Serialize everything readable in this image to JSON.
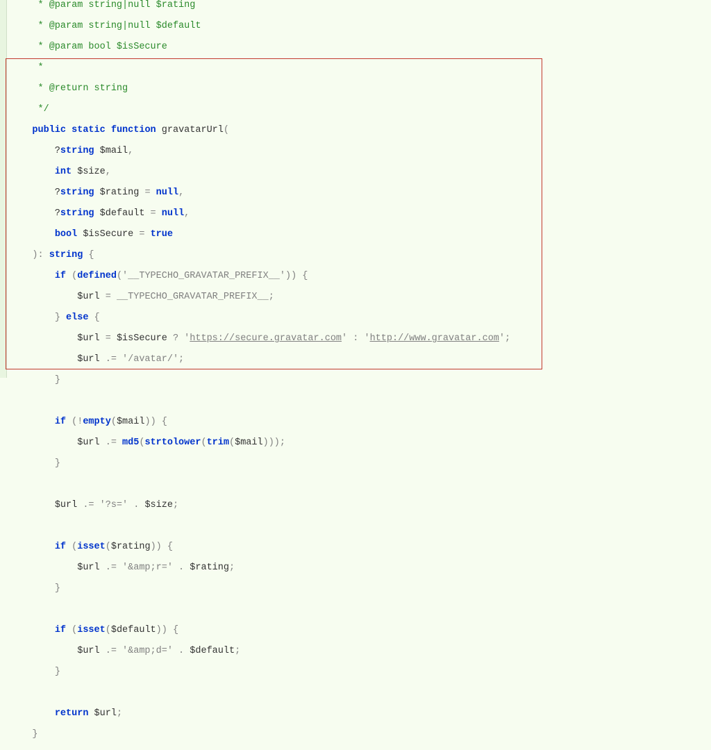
{
  "doc": {
    "l0": "     * @param string|null $rating",
    "l1": "     * @param string|null $default",
    "l2": "     * @param bool $isSecure",
    "l3": "     *",
    "l4": "     * @return string",
    "l5": "     */"
  },
  "code": {
    "sig1": {
      "pre": "    ",
      "k1": "public",
      "s1": " ",
      "k2": "static",
      "s2": " ",
      "k3": "function",
      "s3": " ",
      "fn": "gravatarUrl",
      "open": "("
    },
    "p1": {
      "pre": "        ?",
      "t": "string",
      "s": " ",
      "v": "$mail",
      "c": ","
    },
    "p2": {
      "pre": "        ",
      "t": "int",
      "s": " ",
      "v": "$size",
      "c": ","
    },
    "p3": {
      "pre": "        ?",
      "t": "string",
      "s": " ",
      "v": "$rating",
      "eq": " = ",
      "d": "null",
      "c": ","
    },
    "p4": {
      "pre": "        ?",
      "t": "string",
      "s": " ",
      "v": "$default",
      "eq": " = ",
      "d": "null",
      "c": ","
    },
    "p5": {
      "pre": "        ",
      "t": "bool",
      "s": " ",
      "v": "$isSecure",
      "eq": " = ",
      "d": "true"
    },
    "sig2": {
      "pre": "    ",
      "close": "): ",
      "rt": "string",
      "brace": " {"
    },
    "if1": {
      "pre": "        ",
      "k": "if",
      "open": " (",
      "fn": "defined",
      "paren": "(",
      "str": "'__TYPECHO_GRAVATAR_PREFIX__'",
      "close": ")) {"
    },
    "a1": {
      "pre": "            ",
      "v": "$url",
      "eq": " = ",
      "c": "__TYPECHO_GRAVATAR_PREFIX__",
      "semi": ";"
    },
    "else": {
      "pre": "        ",
      "close": "} ",
      "k": "else",
      "open": " {"
    },
    "a2": {
      "pre": "            ",
      "v": "$url",
      "eq": " = ",
      "cond": "$isSecure",
      "tern": " ? ",
      "q1": "'",
      "u1": "https://secure.gravatar.com",
      "q2": "'",
      "colon": " : ",
      "q3": "'",
      "u2": "http://www.gravatar.com",
      "q4": "'",
      "semi": ";"
    },
    "a3": {
      "pre": "            ",
      "v": "$url",
      "eq": " .= ",
      "s": "'/avatar/'",
      "semi": ";"
    },
    "cb1": {
      "pre": "        ",
      "b": "}"
    },
    "if2": {
      "pre": "        ",
      "k": "if",
      "open": " (!",
      "fn": "empty",
      "paren": "(",
      "v": "$mail",
      "close": ")) {"
    },
    "a4": {
      "pre": "            ",
      "v": "$url",
      "eq": " .= ",
      "f1": "md5",
      "p1": "(",
      "f2": "strtolower",
      "p2": "(",
      "f3": "trim",
      "p3": "(",
      "arg": "$mail",
      "close": ")));"
    },
    "cb2": {
      "pre": "        ",
      "b": "}"
    },
    "a5": {
      "pre": "        ",
      "v": "$url",
      "eq": " .= ",
      "s": "'?s='",
      "cat": " . ",
      "v2": "$size",
      "semi": ";"
    },
    "if3": {
      "pre": "        ",
      "k": "if",
      "open": " (",
      "fn": "isset",
      "paren": "(",
      "v": "$rating",
      "close": ")) {"
    },
    "a6": {
      "pre": "            ",
      "v": "$url",
      "eq": " .= ",
      "s": "'&amp;r='",
      "cat": " . ",
      "v2": "$rating",
      "semi": ";"
    },
    "cb3": {
      "pre": "        ",
      "b": "}"
    },
    "if4": {
      "pre": "        ",
      "k": "if",
      "open": " (",
      "fn": "isset",
      "paren": "(",
      "v": "$default",
      "close": ")) {"
    },
    "a7": {
      "pre": "            ",
      "v": "$url",
      "eq": " .= ",
      "s": "'&amp;d='",
      "cat": " . ",
      "v2": "$default",
      "semi": ";"
    },
    "cb4": {
      "pre": "        ",
      "b": "}"
    },
    "ret": {
      "pre": "        ",
      "k": "return",
      "s": " ",
      "v": "$url",
      "semi": ";"
    },
    "cb5": {
      "pre": "    ",
      "b": "}"
    }
  }
}
